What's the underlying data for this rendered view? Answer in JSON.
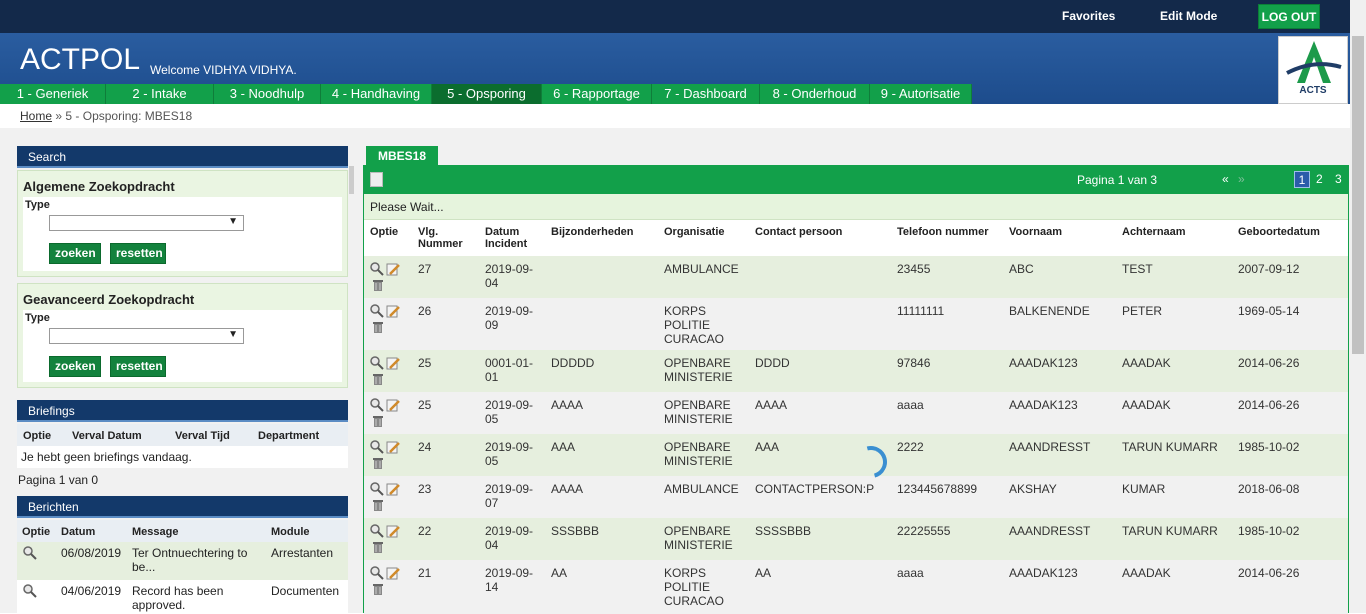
{
  "topbar": {
    "favorites": "Favorites",
    "edit_mode": "Edit Mode",
    "logout": "LOG OUT"
  },
  "header": {
    "app_title": "ACTPOL",
    "welcome": "Welcome VIDHYA VIDHYA.",
    "logo_text": "ACTS"
  },
  "nav": [
    {
      "label": "1 - Generiek"
    },
    {
      "label": "2 - Intake"
    },
    {
      "label": "3 - Noodhulp"
    },
    {
      "label": "4 - Handhaving"
    },
    {
      "label": "5 - Opsporing"
    },
    {
      "label": "6 - Rapportage"
    },
    {
      "label": "7 - Dashboard"
    },
    {
      "label": "8 - Onderhoud"
    },
    {
      "label": "9 - Autorisatie"
    }
  ],
  "breadcrumb": {
    "home": "Home",
    "separator": "»",
    "current": "5 - Opsporing: MBES18"
  },
  "search": {
    "title": "Search",
    "basic": {
      "title": "Algemene Zoekopdracht",
      "type_label": "Type",
      "search": "zoeken",
      "reset": "resetten"
    },
    "advanced": {
      "title": "Geavanceerd Zoekopdracht",
      "type_label": "Type",
      "search": "zoeken",
      "reset": "resetten"
    }
  },
  "briefings": {
    "title": "Briefings",
    "headers": [
      "Optie",
      "Verval Datum",
      "Verval Tijd",
      "Department"
    ],
    "empty": "Je hebt geen briefings vandaag.",
    "pager": "Pagina 1 van 0"
  },
  "messages": {
    "title": "Berichten",
    "headers": [
      "Optie",
      "Datum",
      "Message",
      "Module"
    ],
    "rows": [
      {
        "date": "06/08/2019",
        "message": "Ter Ontnuechtering to be...",
        "module": "Arrestanten"
      },
      {
        "date": "04/06/2019",
        "message": "Record has been approved.",
        "module": "Documenten"
      }
    ]
  },
  "main": {
    "tab": "MBES18",
    "page_info": "Pagina 1 van 3",
    "prev": "«",
    "next": "»",
    "pages": [
      "1",
      "2",
      "3"
    ],
    "wait": "Please Wait...",
    "headers": [
      "Optie",
      "Vlg. Nummer",
      "Datum Incident",
      "Bijzonderheden",
      "Organisatie",
      "Contact persoon",
      "Telefoon nummer",
      "Voornaam",
      "Achternaam",
      "Geboortedatum"
    ],
    "rows": [
      {
        "num": "27",
        "date": "2019-09-04",
        "details": "",
        "org": "AMBULANCE",
        "contact": "",
        "phone": "23455",
        "first": "ABC",
        "last": "TEST",
        "dob": "2007-09-12"
      },
      {
        "num": "26",
        "date": "2019-09-09",
        "details": "",
        "org": "KORPS POLITIE CURACAO",
        "contact": "",
        "phone": "11111111",
        "first": "BALKENENDE",
        "last": "PETER",
        "dob": "1969-05-14"
      },
      {
        "num": "25",
        "date": "0001-01-01",
        "details": "DDDDD",
        "org": "OPENBARE MINISTERIE",
        "contact": "DDDD",
        "phone": "97846",
        "first": "AAADAK123",
        "last": "AAADAK",
        "dob": "2014-06-26"
      },
      {
        "num": "25",
        "date": "2019-09-05",
        "details": "AAAA",
        "org": "OPENBARE MINISTERIE",
        "contact": "AAAA",
        "phone": "aaaa",
        "first": "AAADAK123",
        "last": "AAADAK",
        "dob": "2014-06-26"
      },
      {
        "num": "24",
        "date": "2019-09-05",
        "details": "AAA",
        "org": "OPENBARE MINISTERIE",
        "contact": "AAA",
        "phone": "2222",
        "first": "AAANDRESST",
        "last": "TARUN KUMARR",
        "dob": "1985-10-02"
      },
      {
        "num": "23",
        "date": "2019-09-07",
        "details": "AAAA",
        "org": "AMBULANCE",
        "contact": "CONTACTPERSON:P",
        "phone": "123445678899",
        "first": "AKSHAY",
        "last": "KUMAR",
        "dob": "2018-06-08"
      },
      {
        "num": "22",
        "date": "2019-09-04",
        "details": "SSSBBB",
        "org": "OPENBARE MINISTERIE",
        "contact": "SSSSBBB",
        "phone": "22225555",
        "first": "AAANDRESST",
        "last": "TARUN KUMARR",
        "dob": "1985-10-02"
      },
      {
        "num": "21",
        "date": "2019-09-14",
        "details": "AA",
        "org": "KORPS POLITIE CURACAO",
        "contact": "AA",
        "phone": "aaaa",
        "first": "AAADAK123",
        "last": "AAADAK",
        "dob": "2014-06-26"
      }
    ]
  },
  "colors": {
    "topbar": "#13294a",
    "header": "#2a5da0",
    "accent_green": "#12a04a",
    "panel_header": "#13396a"
  }
}
